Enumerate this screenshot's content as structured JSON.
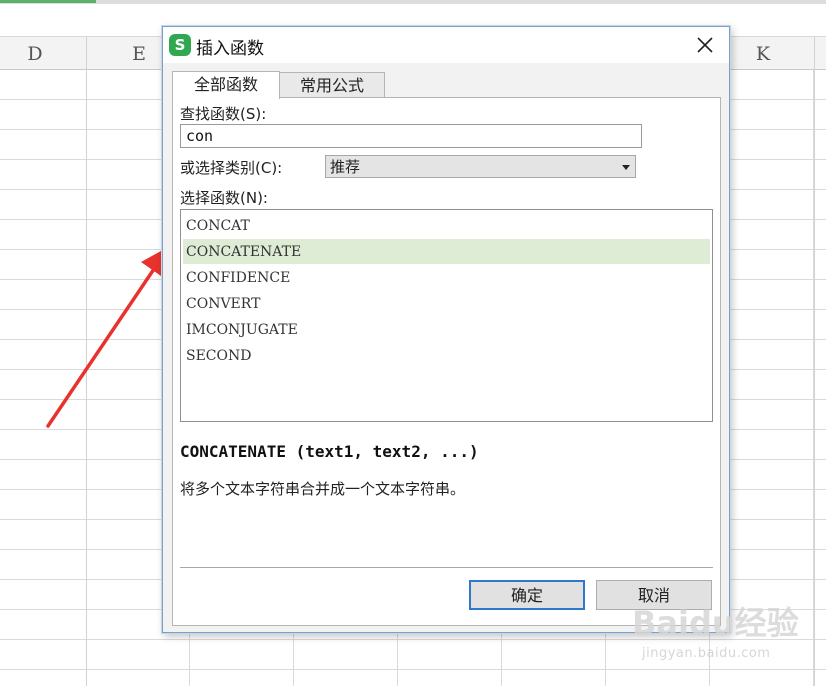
{
  "spreadsheet": {
    "columns": [
      {
        "label": "D"
      },
      {
        "label": "E"
      },
      {
        "label": "K"
      }
    ]
  },
  "dialog": {
    "title": "插入函数",
    "app_icon": "S",
    "close_icon": "close-icon",
    "tabs": [
      {
        "label": "全部函数",
        "active": true
      },
      {
        "label": "常用公式",
        "active": false
      }
    ],
    "search_label": "查找函数(S):",
    "search_value": "con",
    "category_label": "或选择类别(C):",
    "category_value": "推荐",
    "function_list_label": "选择函数(N):",
    "functions": [
      "CONCAT",
      "CONCATENATE",
      "CONFIDENCE",
      "CONVERT",
      "IMCONJUGATE",
      "SECOND"
    ],
    "selected_function": "CONCATENATE",
    "signature": "CONCATENATE (text1, text2, ...)",
    "description": "将多个文本字符串合并成一个文本字符串。",
    "ok_label": "确定",
    "cancel_label": "取消"
  },
  "annotation": {
    "arrow_color": "#e8322d"
  },
  "watermark": {
    "text": "Baidu经验",
    "url": "jingyan.baidu.com"
  },
  "colors": {
    "selected_row": "#deecd6",
    "app_icon": "#2fa84f",
    "ok_border": "#2f77c9"
  }
}
